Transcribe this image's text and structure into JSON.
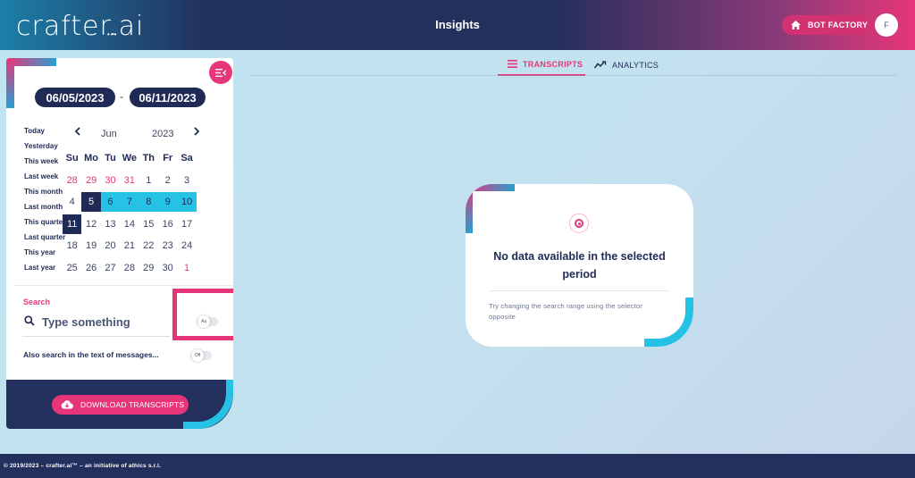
{
  "header": {
    "logo_text": "crafter.ai",
    "logo_dots": "•••",
    "page_title": "Insights",
    "bot_factory_label": "BOT FACTORY",
    "avatar_initial": "F"
  },
  "filters": {
    "date_from": "06/05/2023",
    "date_separator": "-",
    "date_to": "06/11/2023",
    "presets": [
      "Today",
      "Yesterday",
      "This week",
      "Last week",
      "This month",
      "Last month",
      "This quarter",
      "Last quarter",
      "This year",
      "Last year"
    ]
  },
  "calendar": {
    "prev_icon": "‹",
    "next_icon": "›",
    "month": "Jun",
    "year": "2023",
    "weekdays": [
      "Su",
      "Mo",
      "Tu",
      "We",
      "Th",
      "Fr",
      "Sa"
    ],
    "weeks": [
      [
        {
          "d": "28",
          "s": "out"
        },
        {
          "d": "29",
          "s": "out"
        },
        {
          "d": "30",
          "s": "out"
        },
        {
          "d": "31",
          "s": "out"
        },
        {
          "d": "1",
          "s": ""
        },
        {
          "d": "2",
          "s": ""
        },
        {
          "d": "3",
          "s": ""
        }
      ],
      [
        {
          "d": "4",
          "s": ""
        },
        {
          "d": "5",
          "s": "edge"
        },
        {
          "d": "6",
          "s": "range"
        },
        {
          "d": "7",
          "s": "range"
        },
        {
          "d": "8",
          "s": "range"
        },
        {
          "d": "9",
          "s": "range"
        },
        {
          "d": "10",
          "s": "range"
        }
      ],
      [
        {
          "d": "11",
          "s": "edge"
        },
        {
          "d": "12",
          "s": ""
        },
        {
          "d": "13",
          "s": ""
        },
        {
          "d": "14",
          "s": ""
        },
        {
          "d": "15",
          "s": ""
        },
        {
          "d": "16",
          "s": ""
        },
        {
          "d": "17",
          "s": ""
        }
      ],
      [
        {
          "d": "18",
          "s": ""
        },
        {
          "d": "19",
          "s": ""
        },
        {
          "d": "20",
          "s": ""
        },
        {
          "d": "21",
          "s": ""
        },
        {
          "d": "22",
          "s": ""
        },
        {
          "d": "23",
          "s": ""
        },
        {
          "d": "24",
          "s": ""
        }
      ],
      [
        {
          "d": "25",
          "s": ""
        },
        {
          "d": "26",
          "s": ""
        },
        {
          "d": "27",
          "s": ""
        },
        {
          "d": "28",
          "s": ""
        },
        {
          "d": "29",
          "s": ""
        },
        {
          "d": "30",
          "s": ""
        },
        {
          "d": "1",
          "s": "out"
        }
      ]
    ]
  },
  "search": {
    "label": "Search",
    "placeholder": "Type something",
    "value": "",
    "case_toggle_label": "Aa",
    "messages_label": "Also search in the text of messages...",
    "messages_toggle_label": "Off"
  },
  "download": {
    "label": "DOWNLOAD TRANSCRIPTS"
  },
  "tabs": {
    "transcripts": "TRANSCRIPTS",
    "analytics": "ANALYTICS"
  },
  "empty_state": {
    "title": "No data available in the selected period",
    "text": "Try changing the search range using the selector opposite"
  },
  "footer": {
    "text": "© 2019/2023 – crafter.ai™ – an initiative of athics s.r.l."
  },
  "colors": {
    "brand_pink": "#e8357a",
    "navy": "#232f5c",
    "cyan": "#25c2e6"
  }
}
